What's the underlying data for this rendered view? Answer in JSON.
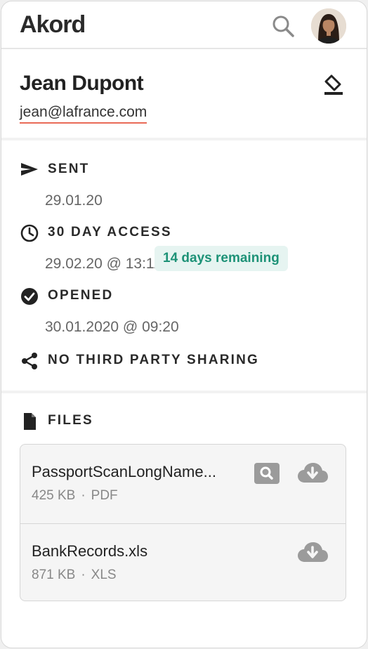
{
  "app": {
    "logo": "Akord"
  },
  "header": {
    "search_icon": "search-icon",
    "avatar_icon": "user-avatar"
  },
  "recipient": {
    "name": "Jean Dupont",
    "email": "jean@lafrance.com",
    "edit_icon": "eraser-icon"
  },
  "details": {
    "sent": {
      "icon": "send-icon",
      "title": "SENT",
      "value": "29.01.20"
    },
    "access": {
      "icon": "clock-icon",
      "title": "30 DAY ACCESS",
      "value": "29.02.20 @ 13:11",
      "badge": "14 days remaining"
    },
    "opened": {
      "icon": "check-circle-icon",
      "title": "OPENED",
      "value": "30.01.2020 @ 09:20"
    },
    "sharing": {
      "icon": "share-icon",
      "title": "NO THIRD PARTY SHARING"
    }
  },
  "files": {
    "icon": "file-icon",
    "title": "FILES",
    "items": [
      {
        "name": "PassportScanLongName...",
        "size": "425 KB",
        "type": "PDF",
        "preview": true
      },
      {
        "name": "BankRecords.xls",
        "size": "871 KB",
        "type": "XLS",
        "preview": false
      }
    ]
  },
  "colors": {
    "accent_underline": "#e96a57",
    "badge_bg": "#e6f4f1",
    "badge_text": "#1d9277"
  }
}
